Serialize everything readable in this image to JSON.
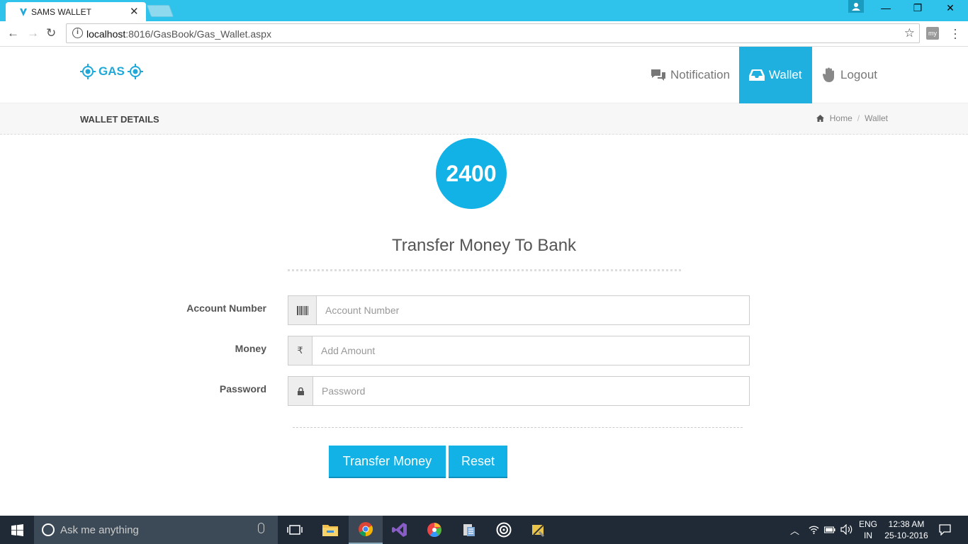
{
  "browser": {
    "tab_title": "SAMS WALLET",
    "url_host": "localhost",
    "url_rest": ":8016/GasBook/Gas_Wallet.aspx",
    "extension_label": "my"
  },
  "header": {
    "logo_text": "GAS",
    "nav": [
      {
        "label": "Notification",
        "icon": "comments-icon"
      },
      {
        "label": "Wallet",
        "icon": "inbox-icon"
      },
      {
        "label": "Logout",
        "icon": "hand-icon"
      }
    ]
  },
  "crumbbar": {
    "title": "WALLET DETAILS",
    "breadcrumb": [
      "Home",
      "Wallet"
    ]
  },
  "main": {
    "balance": "2400",
    "section_title": "Transfer Money To Bank",
    "fields": [
      {
        "label": "Account Number",
        "placeholder": "Account Number",
        "addon_icon": "barcode-icon"
      },
      {
        "label": "Money",
        "placeholder": "Add Amount",
        "addon_text": "₹"
      },
      {
        "label": "Password",
        "placeholder": "Password",
        "addon_icon": "lock-icon"
      }
    ],
    "buttons": {
      "transfer": "Transfer Money",
      "reset": "Reset"
    }
  },
  "taskbar": {
    "search_placeholder": "Ask me anything",
    "lang_top": "ENG",
    "lang_bottom": "IN",
    "time": "12:38 AM",
    "date": "25-10-2016"
  },
  "colors": {
    "accent": "#12b1e6",
    "chrome": "#2fc3ec",
    "taskbar": "#1f2a36"
  }
}
